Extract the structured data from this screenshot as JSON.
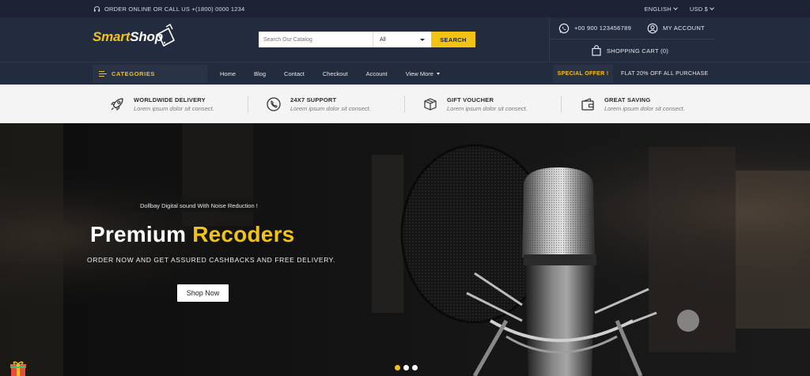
{
  "topbar": {
    "order_text": "ORDER ONLINE OR CALL US +(1800) 0000 1234",
    "language": "ENGLISH",
    "currency": "USD $"
  },
  "header": {
    "logo_part1": "Smart",
    "logo_part2": "Shop",
    "search": {
      "placeholder": "Search Our Catalog",
      "category": "All",
      "button": "SEARCH"
    },
    "phone": "+00 900 123456789",
    "account": "MY ACCOUNT",
    "cart": "SHOPPING CART (0)"
  },
  "nav": {
    "categories": "CATEGORIES",
    "items": [
      "Home",
      "Blog",
      "Contact",
      "Checkout",
      "Account",
      "View More"
    ],
    "offer_label": "SPECIAL OFFER !",
    "offer_text": "FLAT 20% OFF ALL PURCHASE"
  },
  "features": [
    {
      "title": "WORLDWIDE DELIVERY",
      "desc": "Lorem ipsum dolor sit consect.",
      "icon": "rocket-icon"
    },
    {
      "title": "24X7 SUPPORT",
      "desc": "Lorem ipsum dolor sit consect.",
      "icon": "phone-support-icon"
    },
    {
      "title": "GIFT VOUCHER",
      "desc": "Lorem ipsum dolor sit consect.",
      "icon": "gift-box-icon"
    },
    {
      "title": "GREAT SAVING",
      "desc": "Lorem ipsum dolor sit consect.",
      "icon": "wallet-icon"
    }
  ],
  "hero": {
    "subtitle": "Dollbay Digital sound With Noise Reduction !",
    "title_white": "Premium",
    "title_yellow": "Recoders",
    "tagline": "ORDER NOW AND GET ASSURED CASHBACKS AND FREE DELIVERY.",
    "button": "Shop Now",
    "slides": 3,
    "active_slide": 1
  },
  "colors": {
    "accent": "#f3c313",
    "header_bg": "#232b3e",
    "topbar_bg": "#1d2334",
    "features_bg": "#f4f4f4"
  }
}
